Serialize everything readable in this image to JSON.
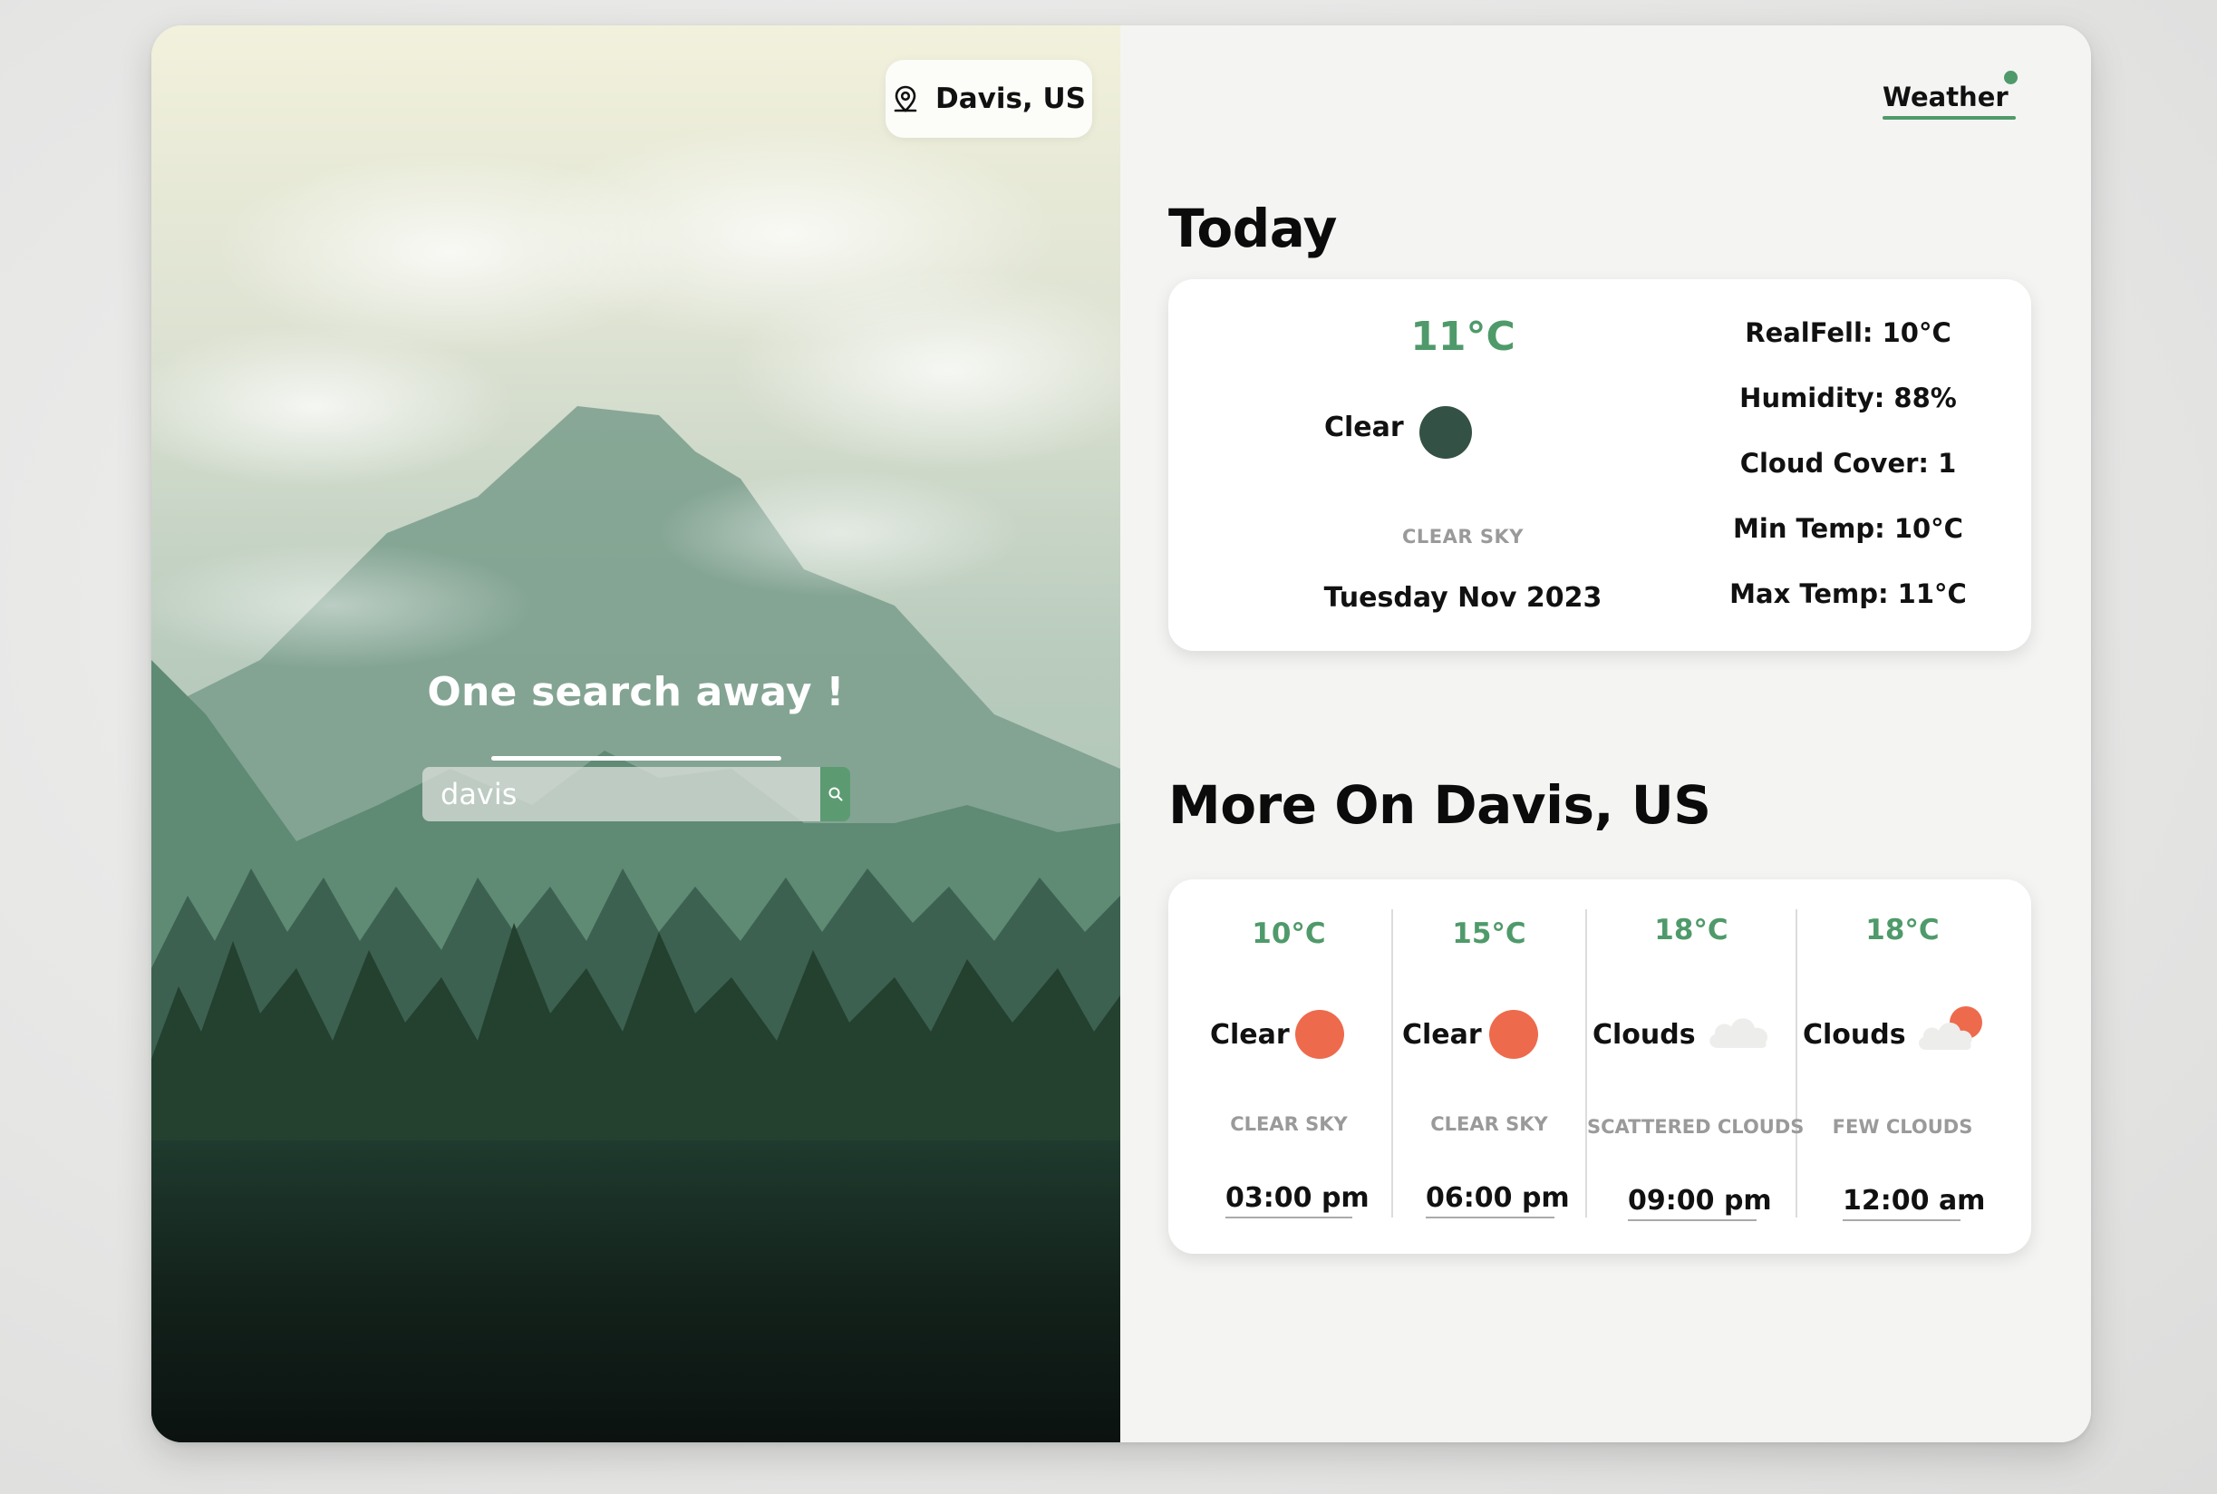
{
  "location": {
    "label": "Davis, US"
  },
  "hero": {
    "title": "One search away !"
  },
  "search": {
    "value": "davis",
    "placeholder": ""
  },
  "nav": {
    "weather_label": "Weather"
  },
  "today": {
    "title": "Today",
    "temperature": "11°C",
    "condition": "Clear",
    "description": "CLEAR SKY",
    "date": "Tuesday Nov 2023",
    "stats": [
      "RealFell: 10°C",
      "Humidity: 88%",
      "Cloud Cover: 1",
      "Min Temp: 10°C",
      "Max Temp: 11°C"
    ]
  },
  "more": {
    "title": "More On Davis, US",
    "forecasts": [
      {
        "temperature": "10°C",
        "condition": "Clear",
        "description": "CLEAR SKY",
        "time": "03:00 pm",
        "icon": "sun-icon"
      },
      {
        "temperature": "15°C",
        "condition": "Clear",
        "description": "CLEAR SKY",
        "time": "06:00 pm",
        "icon": "sun-icon"
      },
      {
        "temperature": "18°C",
        "condition": "Clouds",
        "description": "SCATTERED CLOUDS",
        "time": "09:00 pm",
        "icon": "cloud-icon"
      },
      {
        "temperature": "18°C",
        "condition": "Clouds",
        "description": "FEW CLOUDS",
        "time": "12:00 am",
        "icon": "cloud-sun-icon"
      }
    ]
  },
  "colors": {
    "accent": "#4f9a6a",
    "sun": "#ee6a4c",
    "night_icon": "#345145"
  }
}
